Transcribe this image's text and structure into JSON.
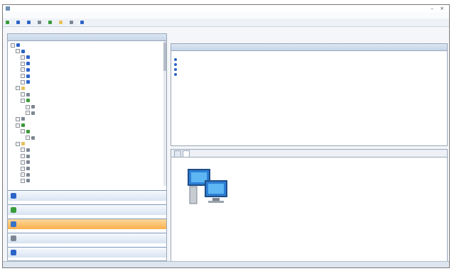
{
  "window": {
    "title": "",
    "minimize_glyph": "–",
    "close_glyph": "×"
  },
  "menu": {
    "items": [
      "",
      "",
      "",
      "",
      ""
    ]
  },
  "toolbar": {
    "buttons": [
      "",
      "",
      "",
      "",
      "",
      "",
      "",
      ""
    ]
  },
  "left_pane": {
    "title": "",
    "nav": [
      {
        "label": "",
        "icon": "management-icon",
        "active": false
      },
      {
        "label": "",
        "icon": "monitoring-icon",
        "active": false
      },
      {
        "label": "",
        "icon": "deployment-icon",
        "active": true
      },
      {
        "label": "",
        "icon": "reports-icon",
        "active": false
      },
      {
        "label": "",
        "icon": "administration-icon",
        "active": false
      }
    ]
  },
  "tree": [
    {
      "label": "",
      "level": 0,
      "icon": "blue",
      "selected": false
    },
    {
      "label": "",
      "level": 1,
      "icon": "blue",
      "selected": true
    },
    {
      "label": "",
      "level": 2,
      "icon": "blue",
      "selected": false
    },
    {
      "label": "",
      "level": 2,
      "icon": "blue",
      "selected": false
    },
    {
      "label": "",
      "level": 2,
      "icon": "blue",
      "selected": false
    },
    {
      "label": "",
      "level": 2,
      "icon": "blue",
      "selected": false
    },
    {
      "label": "",
      "level": 2,
      "icon": "blue",
      "selected": false
    },
    {
      "label": "",
      "level": 1,
      "icon": "folder",
      "selected": false
    },
    {
      "label": "",
      "level": 2,
      "icon": "grey",
      "selected": false
    },
    {
      "label": "",
      "level": 2,
      "icon": "green",
      "selected": false
    },
    {
      "label": "",
      "level": 3,
      "icon": "grey",
      "selected": false
    },
    {
      "label": "",
      "level": 3,
      "icon": "grey",
      "selected": false
    },
    {
      "label": "",
      "level": 1,
      "icon": "grey",
      "selected": false
    },
    {
      "label": "",
      "level": 1,
      "icon": "green",
      "selected": false
    },
    {
      "label": "",
      "level": 2,
      "icon": "green",
      "selected": false
    },
    {
      "label": "",
      "level": 3,
      "icon": "grey",
      "selected": false
    },
    {
      "label": "",
      "level": 1,
      "icon": "folder",
      "selected": false
    },
    {
      "label": "",
      "level": 2,
      "icon": "grey",
      "selected": false
    },
    {
      "label": "",
      "level": 2,
      "icon": "grey",
      "selected": false
    },
    {
      "label": "",
      "level": 2,
      "icon": "grey",
      "selected": false
    },
    {
      "label": "",
      "level": 2,
      "icon": "grey",
      "selected": false
    },
    {
      "label": "",
      "level": 2,
      "icon": "grey",
      "selected": false
    },
    {
      "label": "",
      "level": 2,
      "icon": "grey",
      "selected": false
    }
  ],
  "grid": {
    "title": "",
    "columns": [
      "",
      "",
      ""
    ],
    "rows": [
      {
        "name": "",
        "os": "",
        "count": ""
      },
      {
        "name": "",
        "os": "",
        "count": ""
      },
      {
        "name": "",
        "os": "",
        "count": ""
      },
      {
        "name": "",
        "os": "",
        "count": ""
      }
    ]
  },
  "detail": {
    "tabs": [
      {
        "label": "",
        "active": false
      },
      {
        "label": "",
        "active": true
      }
    ],
    "icon_caption": "",
    "field_label": "",
    "field_value": ""
  },
  "status": {
    "left": "",
    "right": ""
  },
  "colors": {
    "accent": "#3b72c7",
    "active_nav": "#fbb04c",
    "header": "#c6d5e8"
  }
}
